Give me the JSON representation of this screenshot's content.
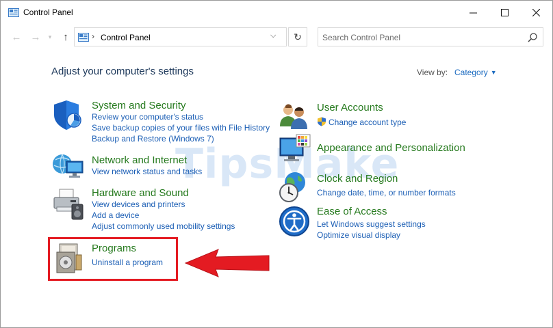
{
  "window": {
    "title": "Control Panel"
  },
  "nav": {
    "back_glyph": "←",
    "forward_glyph": "→",
    "recent_glyph": "▾",
    "up_glyph": "↑"
  },
  "address": {
    "separator": "›",
    "path": "Control Panel",
    "dropdown_glyph": "⌵",
    "refresh_glyph": "↻"
  },
  "search": {
    "placeholder": "Search Control Panel"
  },
  "content": {
    "heading": "Adjust your computer's settings",
    "view_by_label": "View by:",
    "view_by_value": "Category"
  },
  "categories": {
    "system_security": {
      "title": "System and Security",
      "links": [
        "Review your computer's status",
        "Save backup copies of your files with File History",
        "Backup and Restore (Windows 7)"
      ]
    },
    "network_internet": {
      "title": "Network and Internet",
      "links": [
        "View network status and tasks"
      ]
    },
    "hardware_sound": {
      "title": "Hardware and Sound",
      "links": [
        "View devices and printers",
        "Add a device",
        "Adjust commonly used mobility settings"
      ]
    },
    "programs": {
      "title": "Programs",
      "links": [
        "Uninstall a program"
      ]
    },
    "user_accounts": {
      "title": "User Accounts",
      "links": [
        "Change account type"
      ]
    },
    "appearance": {
      "title": "Appearance and Personalization",
      "links": []
    },
    "clock_region": {
      "title": "Clock and Region",
      "links": [
        "Change date, time, or number formats"
      ]
    },
    "ease_access": {
      "title": "Ease of Access",
      "links": [
        "Let Windows suggest settings",
        "Optimize visual display"
      ]
    }
  },
  "watermark": {
    "text": "TipsMake"
  },
  "colors": {
    "link": "#1c5fb5",
    "category_title": "#267a1e",
    "heading": "#1e395b",
    "highlight": "#e41b22"
  },
  "icons": [
    "control-panel-icon",
    "search-icon",
    "shield-icon",
    "network-icon",
    "printer-icon",
    "programs-icon",
    "users-icon",
    "monitor-icon",
    "globe-clock-icon",
    "ease-of-access-icon",
    "uac-shield-icon"
  ]
}
